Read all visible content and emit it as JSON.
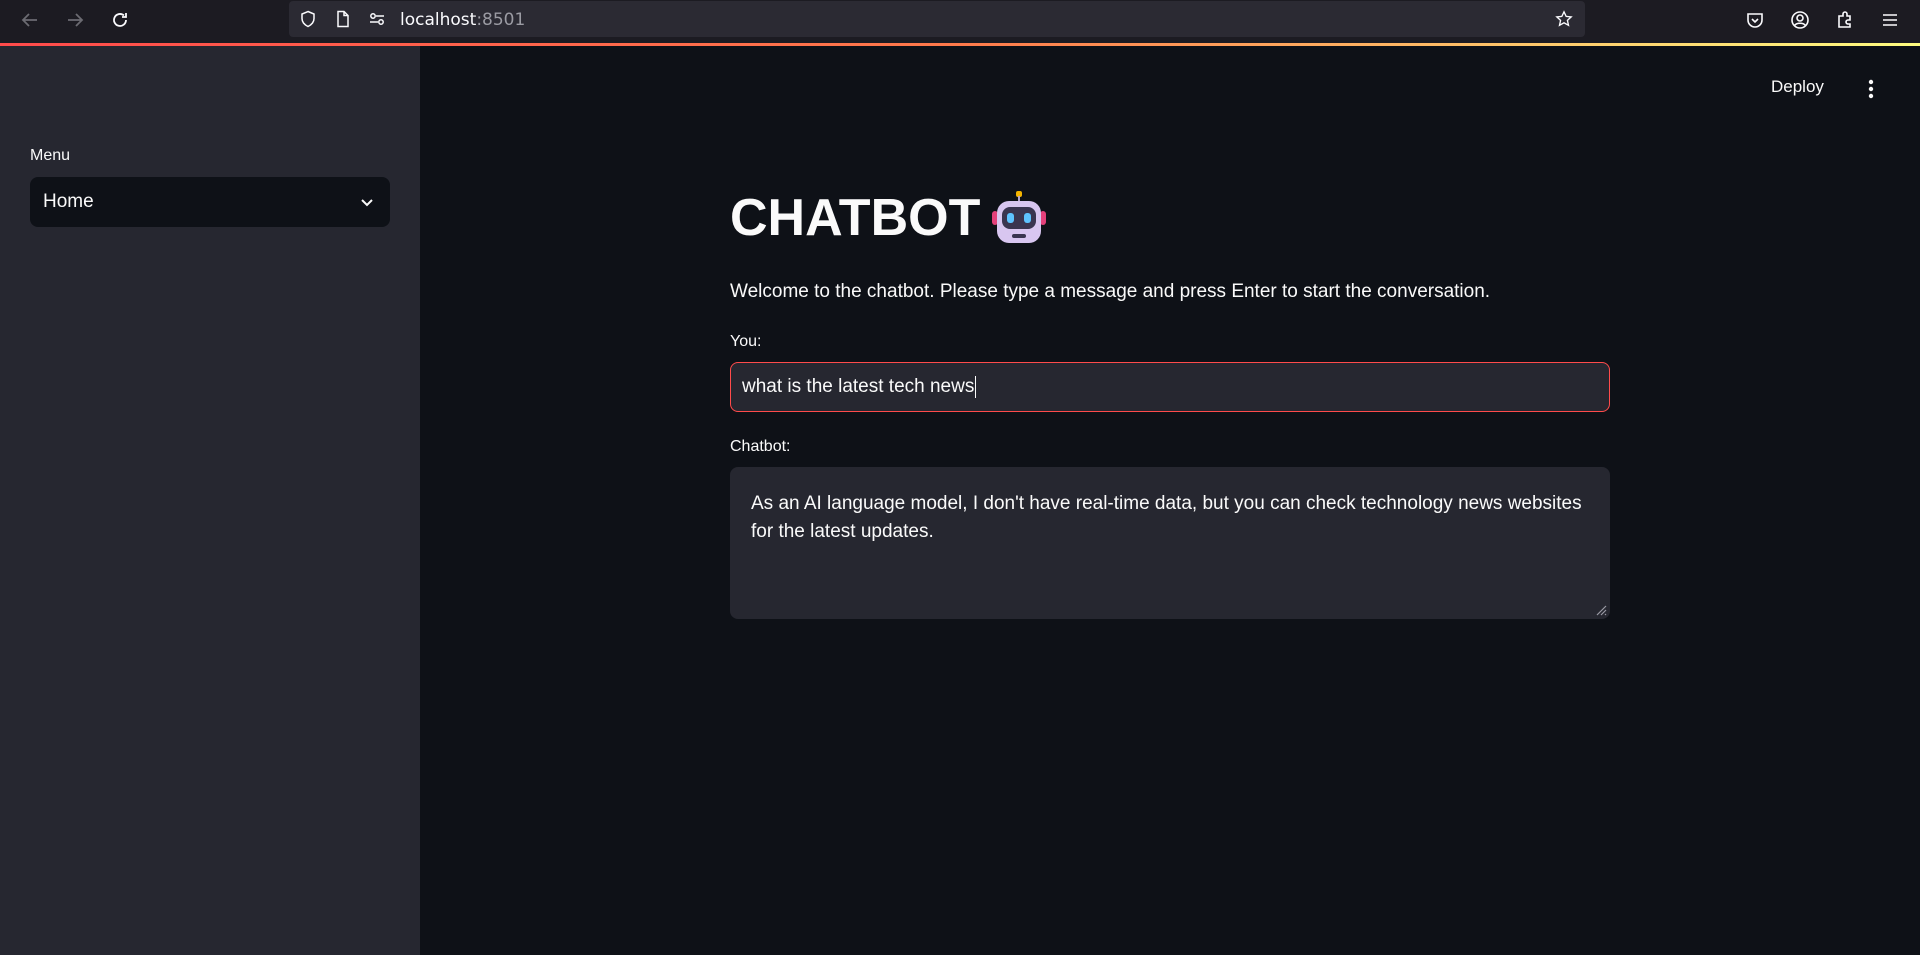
{
  "browser": {
    "url_host": "localhost",
    "url_port": ":8501",
    "icons": [
      "back-icon",
      "forward-icon",
      "reload-icon",
      "shield-icon",
      "page-icon",
      "permissions-icon",
      "bookmark-star-icon",
      "pocket-icon",
      "account-icon",
      "extensions-icon",
      "menu-icon"
    ]
  },
  "sidebar": {
    "menu_label": "Menu",
    "select_value": "Home"
  },
  "header": {
    "deploy_label": "Deploy"
  },
  "main": {
    "title": "CHATBOT",
    "welcome_text": "Welcome to the chatbot. Please type a message and press Enter to start the conversation.",
    "you_label": "You:",
    "you_value": "what is the latest tech news",
    "chatbot_label": "Chatbot:",
    "chatbot_response": "As an AI language model, I don't have real-time data, but you can check technology news websites for the latest updates."
  },
  "colors": {
    "app_bg": "#0e1117",
    "sidebar_bg": "#262730",
    "accent": "#ff4b4b",
    "text": "#fafafa"
  }
}
